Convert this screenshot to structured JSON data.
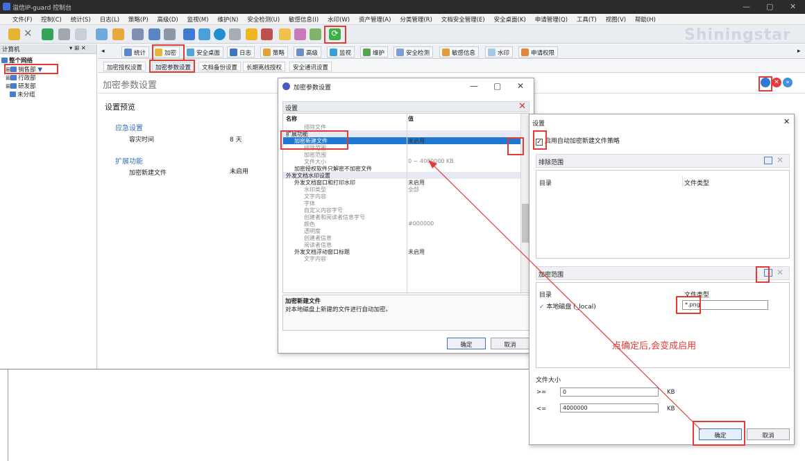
{
  "window": {
    "title": "溢信IP-guard 控制台"
  },
  "menu": [
    "文件(F)",
    "控制(C)",
    "统计(S)",
    "日志(L)",
    "策略(P)",
    "高级(D)",
    "监视(M)",
    "维护(N)",
    "安全检测(U)",
    "敏感信息(I)",
    "水印(W)",
    "资产管理(A)",
    "分类管理(R)",
    "文档安全管理(E)",
    "安全桌面(K)",
    "申请管理(Q)",
    "工具(T)",
    "视图(V)",
    "帮助(H)"
  ],
  "left_panel": {
    "header": "计算机",
    "pin": "▾ ⊞ ✕",
    "tree": [
      "整个网络",
      "销售部",
      "行政部",
      "研发部",
      "未分组"
    ]
  },
  "module_tabs": [
    "统计",
    "加密",
    "安全桌面",
    "日志",
    "策略",
    "高级",
    "监视",
    "维护",
    "安全检测",
    "敏感信息",
    "水印",
    "申请权限"
  ],
  "sub_tabs": [
    "加密授权设置",
    "加密参数设置",
    "文档备份设置",
    "长期离线授权",
    "安全通讯设置"
  ],
  "content": {
    "heading": "加密参数设置",
    "preview_title": "设置预览",
    "sections": [
      {
        "title": "应急设置",
        "label": "容灾时间",
        "value": "8 天"
      },
      {
        "title": "扩展功能",
        "label": "加密新建文件",
        "value": "未启用"
      }
    ]
  },
  "dialog1": {
    "title": "加密参数设置",
    "settings_header": "设置",
    "col_name": "名称",
    "col_value": "值",
    "rows": [
      {
        "n": "排除文件",
        "v": "",
        "k": "grey"
      },
      {
        "n": "扩展功能",
        "v": "",
        "k": "sect"
      },
      {
        "n": "加密新建文件",
        "v": "未启用",
        "k": "sel"
      },
      {
        "n": "排除范围",
        "v": "",
        "k": "grey"
      },
      {
        "n": "加密范围",
        "v": "",
        "k": "grey"
      },
      {
        "n": "文件大小",
        "v": "0 ~ 4000000 KB",
        "k": "grey"
      },
      {
        "n": "加密授权软件只解密不加密文件",
        "v": "",
        "k": ""
      },
      {
        "n": "外发文档水印设置",
        "v": "",
        "k": "sect"
      },
      {
        "n": "外发文档窗口和打印水印",
        "v": "未启用",
        "k": ""
      },
      {
        "n": "水印类型",
        "v": "全部",
        "k": "grey"
      },
      {
        "n": "文字内容",
        "v": "",
        "k": "grey"
      },
      {
        "n": "字体",
        "v": "",
        "k": "grey"
      },
      {
        "n": "自定义内容字号",
        "v": "",
        "k": "grey"
      },
      {
        "n": "创建者和阅读者信息字号",
        "v": "",
        "k": "grey"
      },
      {
        "n": "颜色",
        "v": "#000000",
        "k": "grey"
      },
      {
        "n": "透明度",
        "v": "",
        "k": "grey"
      },
      {
        "n": "创建者信息",
        "v": "",
        "k": "grey"
      },
      {
        "n": "阅读者信息",
        "v": "",
        "k": "grey"
      },
      {
        "n": "外发文档浮动窗口标题",
        "v": "未启用",
        "k": ""
      },
      {
        "n": "文字内容",
        "v": "",
        "k": "grey"
      }
    ],
    "desc_title": "加密新建文件",
    "desc_text": "对本地磁盘上新建的文件进行自动加密。",
    "ok": "确定",
    "cancel": "取消"
  },
  "dialog2": {
    "title": "设置",
    "checkbox_label": "启用自动加密新建文件策略",
    "exclude_header": "排除范围",
    "encrypt_header": "加密范围",
    "col_dir": "目录",
    "col_type": "文件类型",
    "encrypt_dir": "本地磁盘 (_local)",
    "encrypt_type": "*.png",
    "size_label": "文件大小",
    "ge": ">=",
    "le": "<=",
    "min": "0",
    "max": "4000000",
    "unit": "KB",
    "ok": "确定",
    "cancel": "取消"
  },
  "annotation": "点确定后,会变成启用",
  "watermark": "Shiningstar"
}
